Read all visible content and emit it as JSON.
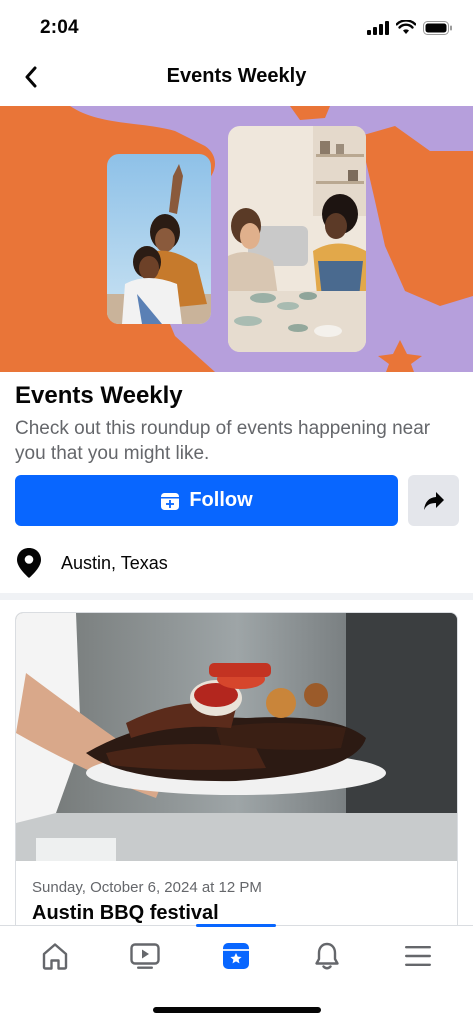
{
  "status_bar": {
    "time": "2:04"
  },
  "header": {
    "title": "Events Weekly",
    "back_icon": "chevron-left-icon"
  },
  "hero": {
    "colors": {
      "orange": "#e97538",
      "lavender": "#b69fdc"
    },
    "photos": [
      "friends-photo",
      "pottery-class-photo"
    ]
  },
  "page": {
    "title": "Events Weekly",
    "description": "Check out this roundup of events happening near you that you might like.",
    "follow_label": "Follow",
    "share_icon": "share-arrow-icon",
    "location": "Austin, Texas"
  },
  "event": {
    "date": "Sunday, October 6, 2024 at 12 PM",
    "name": "Austin BBQ festival",
    "image": "bbq-platter-photo"
  },
  "tabs": [
    {
      "name": "home",
      "icon": "home-icon"
    },
    {
      "name": "video",
      "icon": "video-icon"
    },
    {
      "name": "events",
      "icon": "events-icon",
      "active": true
    },
    {
      "name": "notifications",
      "icon": "bell-icon"
    },
    {
      "name": "menu",
      "icon": "menu-icon"
    }
  ],
  "colors": {
    "accent": "#0866ff",
    "secondary_text": "#65676b",
    "button_gray": "#e4e6eb"
  }
}
